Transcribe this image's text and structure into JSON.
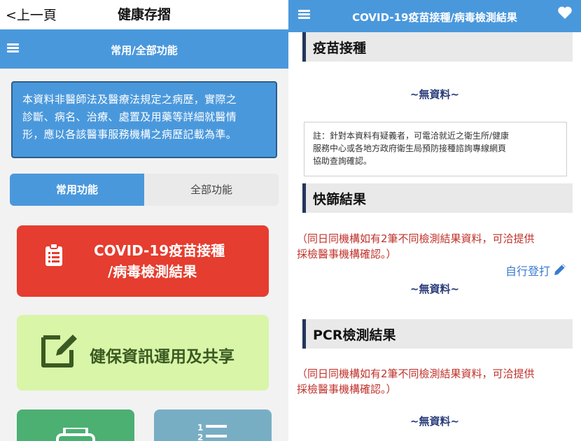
{
  "left": {
    "back_label": "<上一頁",
    "top_title": "健康存摺",
    "menu_title": "常用/全部功能",
    "notice_lines": [
      "本資料非醫師法及醫療法規定之病歷，實際之",
      "診斷、病名、治療、處置及用藥等詳細就醫情",
      "形，應以各該醫事服務機構之病歷記載為準。"
    ],
    "tabs": {
      "common": "常用功能",
      "all": "全部功能"
    },
    "cards": {
      "covid_line1": "COVID-19疫苗接種",
      "covid_line2": "/病毒檢測結果",
      "nhi": "健保資訊運用及共享"
    }
  },
  "right": {
    "title": "COVID-19疫苗接種/病毒檢測結果",
    "sections": {
      "vaccine": "疫苗接種",
      "rapid": "快篩結果",
      "pcr": "PCR檢測結果"
    },
    "no_data": "~無資料~",
    "note_lines": [
      "註：針對本資料有疑義者，可電洽就近之衛生所/健康",
      "服務中心或各地方政府衛生局預防接種諮詢專線網頁",
      "協助查詢確認。"
    ],
    "warn_lines": [
      "（同日同機構如有2筆不同檢測結果資料，可洽提供",
      "採檢醫事機構確認。）"
    ],
    "self_register": "自行登打"
  },
  "colors": {
    "primary_blue": "#4a98dc",
    "covid_card": "#e53d2f",
    "nhi_card": "#d9f5a8",
    "warn_red": "#c0322b",
    "no_data_navy": "#2a3c7a"
  },
  "icons": [
    "menu-icon",
    "clipboard-icon",
    "edit-icon",
    "printer-icon",
    "list-icon",
    "heart-icon",
    "pencil-icon"
  ]
}
